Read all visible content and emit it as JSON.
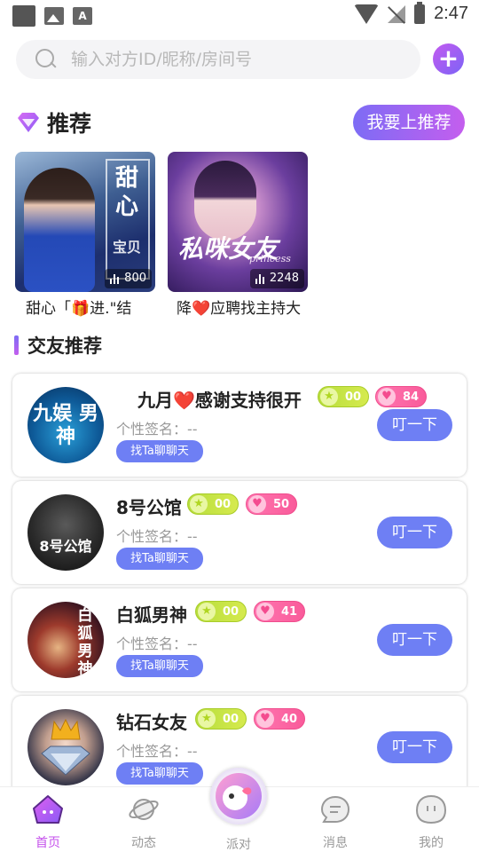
{
  "status_bar": {
    "time": "2:47"
  },
  "search": {
    "placeholder": "输入对方ID/昵称/房间号"
  },
  "recommend": {
    "title": "推荐",
    "button": "我要上推荐",
    "cards": [
      {
        "label": "甜心「🎁进.\"结",
        "count": "800",
        "art_text": "甜心",
        "art_sub": "宝贝"
      },
      {
        "label": "降❤️应聘找主持大",
        "count": "2248",
        "art_text": "私咪女友",
        "art_sub": "princess"
      }
    ]
  },
  "friends": {
    "title": "交友推荐",
    "signature_label": "个性签名：--",
    "chat_label": "找Ta聊聊天",
    "poke_label": "叮一下",
    "users": [
      {
        "name": "九月❤️感谢支持很开",
        "star": "00",
        "heart": "84",
        "avatar_text": "九娱 男神"
      },
      {
        "name": "8号公馆",
        "star": "00",
        "heart": "50",
        "avatar_text": "8号公馆"
      },
      {
        "name": "白狐男神",
        "star": "00",
        "heart": "41",
        "avatar_text": "白狐男神"
      },
      {
        "name": "钻石女友",
        "star": "00",
        "heart": "40",
        "avatar_text": ""
      }
    ]
  },
  "tabbar": {
    "items": [
      {
        "label": "首页",
        "icon": "home-icon"
      },
      {
        "label": "动态",
        "icon": "planet-icon"
      },
      {
        "label": "派对",
        "icon": "party-icon"
      },
      {
        "label": "消息",
        "icon": "message-icon"
      },
      {
        "label": "我的",
        "icon": "profile-icon"
      }
    ]
  },
  "colors": {
    "accent": "#c552ec",
    "button": "#6e7ff4",
    "star_badge": "#b7de3d",
    "heart_badge": "#f95b9a"
  }
}
